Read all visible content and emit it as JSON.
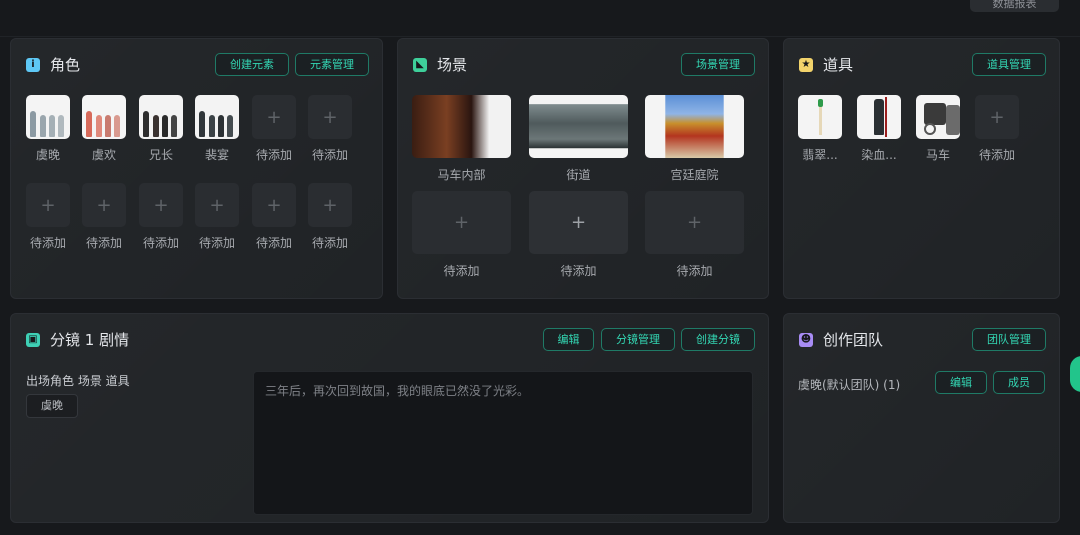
{
  "header": {
    "report_button": "数据报表"
  },
  "roles": {
    "title": "角色",
    "create_element_button": "创建元素",
    "element_manage_button": "元素管理",
    "items": [
      "虞晚",
      "虞欢",
      "兄长",
      "裴宴",
      "待添加",
      "待添加",
      "待添加",
      "待添加",
      "待添加",
      "待添加",
      "待添加",
      "待添加"
    ]
  },
  "scenes": {
    "title": "场景",
    "manage_button": "场景管理",
    "items": [
      "马车内部",
      "街道",
      "宫廷庭院",
      "待添加",
      "待添加",
      "待添加"
    ]
  },
  "props": {
    "title": "道具",
    "manage_button": "道具管理",
    "items": [
      "翡翠...",
      "染血...",
      "马车",
      "待添加"
    ]
  },
  "storyboard": {
    "title": "分镜 1 剧情",
    "edit_button": "编辑",
    "manage_button": "分镜管理",
    "create_button": "创建分镜",
    "elements_label": "出场角色 场景 道具",
    "role_tag": "虞晚",
    "plot_text": "三年后，再次回到故国，我的眼底已然没了光彩。"
  },
  "team": {
    "title": "创作团队",
    "manage_button": "团队管理",
    "team_name": "虞晚(默认团队) (1)",
    "edit_button": "编辑",
    "members_button": "成员"
  },
  "icons": {
    "roles": "info-icon",
    "scenes": "scene-icon",
    "props": "star-icon",
    "storyboard": "storyboard-icon",
    "team": "team-icon",
    "add": "plus-icon"
  },
  "colors": {
    "accent": "#33d6b3",
    "roles_icon": "#5ec8f5",
    "scenes_icon": "#3ed09a",
    "props_icon": "#f2d36b",
    "storyboard_icon": "#3ed0b5",
    "team_icon": "#a88cf5"
  }
}
